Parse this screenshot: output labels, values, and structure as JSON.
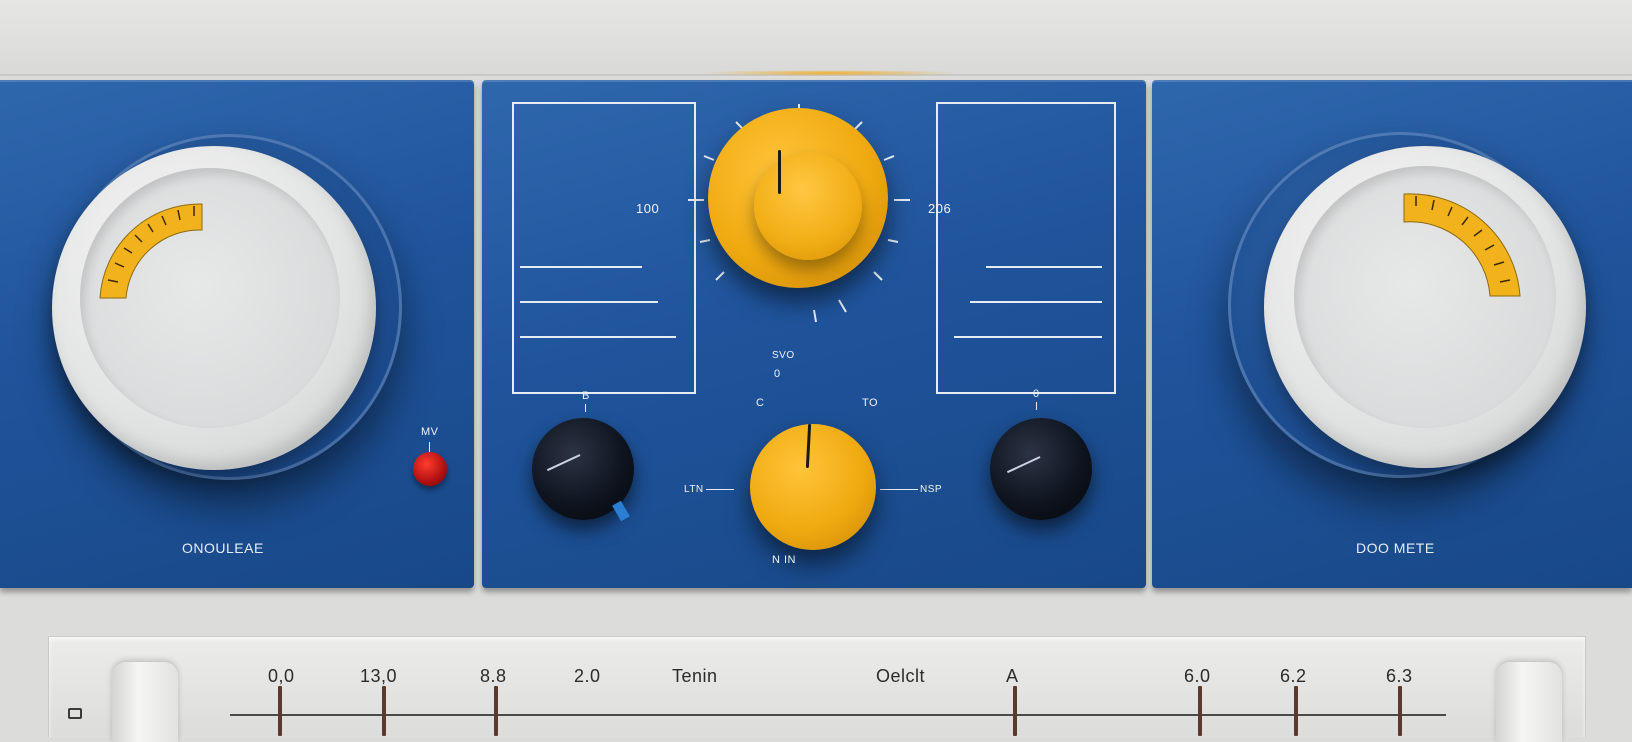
{
  "left_panel": {
    "dial_label": "ONOULEAE",
    "led_label": "MV",
    "led_color": "#c81818"
  },
  "right_panel": {
    "dial_label": "DOO METE"
  },
  "center_panel": {
    "main_knob_left_label": "100",
    "main_knob_right_label": "206",
    "main_knob_bottom_label": "SVO",
    "knob_left_label": "B",
    "knob_right_label": "0",
    "small_knob_top_label": "0",
    "small_knob_top_left_label": "C",
    "small_knob_top_right_label": "TO",
    "small_knob_left_label": "LTN",
    "small_knob_right_label": "NSP",
    "small_knob_bottom_label": "N IN"
  },
  "bottom_scale": {
    "labels": [
      "0,0",
      "13,0",
      "8.8",
      "2.0",
      "Tenin",
      "Oelclt",
      "A",
      "6.0",
      "6.2",
      "6.3"
    ],
    "left_icon": "printer-icon"
  },
  "colors": {
    "panel_blue": "#1f549c",
    "accent_yellow": "#f0aa10",
    "dial_white": "#e3e4e4"
  }
}
